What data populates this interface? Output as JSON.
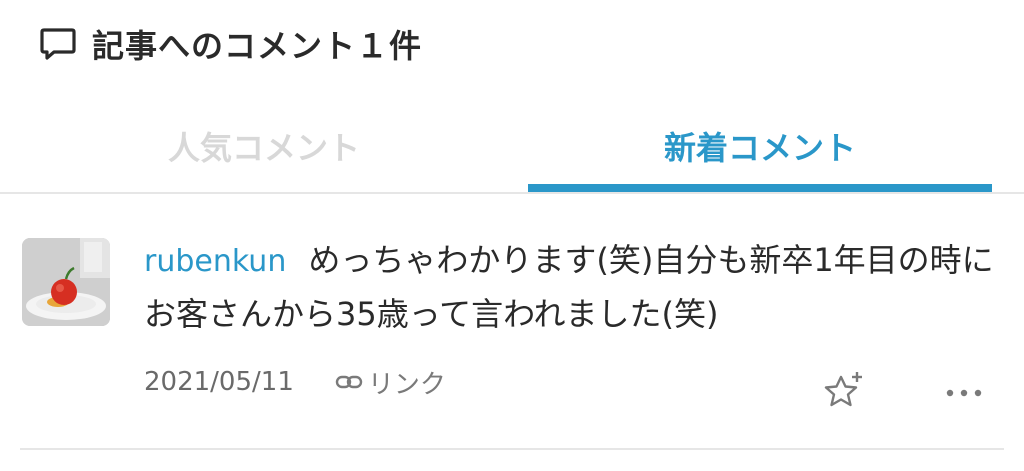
{
  "header": {
    "title": "記事へのコメント１件",
    "icon": "comment-icon"
  },
  "tabs": [
    {
      "label": "人気コメント",
      "active": false
    },
    {
      "label": "新着コメント",
      "active": true
    }
  ],
  "colors": {
    "accent": "#2a97c9",
    "inactive_tab": "#d8d8d8",
    "text": "#2a2a2a",
    "meta_text": "#6a6a6a",
    "divider": "#e6e6e6"
  },
  "comment": {
    "username": "rubenkun",
    "text": "めっちゃわかります(笑)自分も新卒1年目の時にお客さんから35歳って言われました(笑)",
    "date": "2021/05/11",
    "link_label": "リンク",
    "avatar_icon": "avatar",
    "link_icon": "link-icon",
    "star_icon": "add-star-icon",
    "more_icon": "more-icon"
  }
}
